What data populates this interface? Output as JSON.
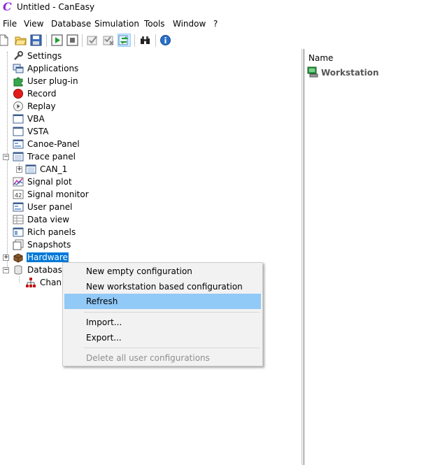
{
  "window": {
    "title": "Untitled - CanEasy",
    "icon": "caneasy-logo-icon"
  },
  "menu": [
    "File",
    "View",
    "Database",
    "Simulation",
    "Tools",
    "Window",
    "?"
  ],
  "toolbar": [
    "new-icon",
    "open-icon",
    "save-icon",
    "run-icon",
    "stop-icon",
    "check-icon",
    "check-x-icon",
    "refresh-icon",
    "binoculars-icon",
    "info-icon"
  ],
  "tree": {
    "settings": "Settings",
    "applications": "Applications",
    "user_plugin": "User plug-in",
    "record": "Record",
    "replay": "Replay",
    "vba": "VBA",
    "vsta": "VSTA",
    "canoe_panel": "Canoe-Panel",
    "trace_panel": "Trace panel",
    "can_1": "CAN_1",
    "signal_plot": "Signal plot",
    "signal_monitor": "Signal monitor",
    "user_panel": "User panel",
    "data_view": "Data view",
    "rich_panels": "Rich panels",
    "snapshots": "Snapshots",
    "hardware": "Hardware",
    "database": "Database",
    "channel": "Chan"
  },
  "right": {
    "header": "Name",
    "workstation": "Workstation"
  },
  "context_menu": {
    "new_empty": "New empty configuration",
    "new_workstation": "New workstation based configuration",
    "refresh": "Refresh",
    "import": "Import...",
    "export": "Export...",
    "delete_all": "Delete all user configurations"
  },
  "colors": {
    "selection": "#0078d7",
    "menu_highlight": "#91c9f7"
  }
}
